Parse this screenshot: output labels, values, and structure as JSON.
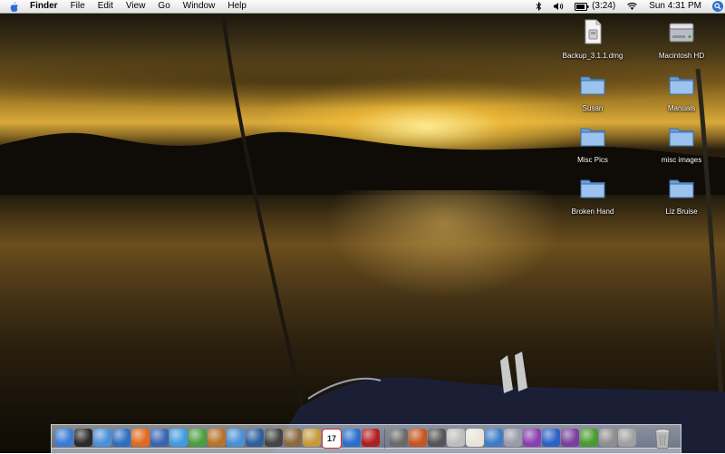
{
  "menubar": {
    "app_name": "Finder",
    "menus": [
      "File",
      "Edit",
      "View",
      "Go",
      "Window",
      "Help"
    ],
    "status": {
      "battery": "(3:24)",
      "clock": "Sun 4:31 PM"
    },
    "icons": [
      "apple-icon",
      "bluetooth-icon",
      "volume-icon",
      "battery-icon",
      "wifi-icon",
      "spotlight-icon"
    ]
  },
  "desktop_icons": [
    {
      "label": "Backup_3.1.1.dmg",
      "icon": "disk-image-icon"
    },
    {
      "label": "Macintosh HD",
      "icon": "hard-drive-icon"
    },
    {
      "label": "Susan",
      "icon": "folder-icon"
    },
    {
      "label": "Manuals",
      "icon": "folder-icon"
    },
    {
      "label": "Misc Pics",
      "icon": "folder-icon"
    },
    {
      "label": "misc images",
      "icon": "folder-icon"
    },
    {
      "label": "Broken Hand",
      "icon": "folder-icon"
    },
    {
      "label": "Liz Bruise",
      "icon": "folder-icon"
    }
  ],
  "dock": {
    "apps": [
      {
        "name": "finder-icon",
        "color": "#3a7bd5"
      },
      {
        "name": "dashboard-icon",
        "color": "#2b2b2b"
      },
      {
        "name": "safari-icon",
        "color": "#4a90d9"
      },
      {
        "name": "internet-explorer-icon",
        "color": "#2f6fc0"
      },
      {
        "name": "firefox-icon",
        "color": "#e06a1f"
      },
      {
        "name": "thunderbird-icon",
        "color": "#3a64b0"
      },
      {
        "name": "ichat-icon",
        "color": "#3f9be0"
      },
      {
        "name": "messenger-icon",
        "color": "#4aa040"
      },
      {
        "name": "garageband-icon",
        "color": "#b5742a"
      },
      {
        "name": "itunes-icon",
        "color": "#4b8fd6"
      },
      {
        "name": "iphoto-icon",
        "color": "#2f5f9f"
      },
      {
        "name": "imovie-icon",
        "color": "#444444"
      },
      {
        "name": "preview-icon",
        "color": "#8a6a40"
      },
      {
        "name": "photo-app-icon",
        "color": "#c49a3a"
      },
      {
        "name": "ical-icon",
        "color": "#d83a2e"
      },
      {
        "name": "quicktime-icon",
        "color": "#2c6fcb"
      },
      {
        "name": "flash-icon",
        "color": "#b01e1e"
      },
      {
        "name": "sync-icon",
        "color": "#6a6a6a"
      },
      {
        "name": "umbrella-icon",
        "color": "#c8541e"
      },
      {
        "name": "spider-icon",
        "color": "#555555"
      },
      {
        "name": "ipod-icon",
        "color": "#bdbdbd"
      },
      {
        "name": "textedit-icon",
        "color": "#e9e4d8"
      },
      {
        "name": "network-icon",
        "color": "#3d7cc9"
      },
      {
        "name": "script-editor-icon",
        "color": "#9a9aa8"
      },
      {
        "name": "app-v-icon",
        "color": "#8a3fb0"
      },
      {
        "name": "word-icon",
        "color": "#2d62c4"
      },
      {
        "name": "app-p-icon",
        "color": "#7a3f9d"
      },
      {
        "name": "app-h-icon",
        "color": "#4b9a2e"
      },
      {
        "name": "finder-apps-icon",
        "color": "#8f8f8f"
      },
      {
        "name": "system-preferences-icon",
        "color": "#a0a0a0"
      }
    ],
    "trash": "trash-icon",
    "calendar_day": "17"
  }
}
